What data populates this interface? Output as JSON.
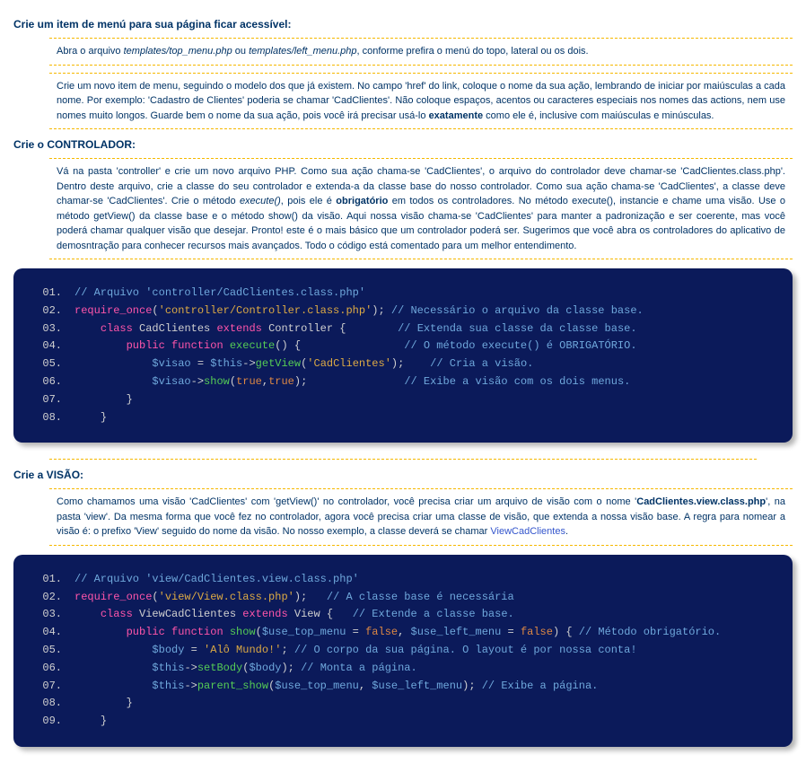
{
  "section1": {
    "heading": "Crie um item de menú para sua página ficar acessível:",
    "para1_pre": "Abra o arquivo ",
    "para1_file1": "templates/top_menu.php",
    "para1_mid": " ou ",
    "para1_file2": "templates/left_menu.php",
    "para1_post": ", conforme prefira o menú do topo, lateral ou os dois.",
    "para2_a": "Crie um novo item de menu, seguindo o modelo dos que já existem. No campo 'href' do link, coloque o nome da sua ação, lembrando de iniciar por maiúsculas a cada nome. Por exemplo: 'Cadastro de Clientes' poderia se chamar 'CadClientes'. Não coloque espaços, acentos ou caracteres especiais nos nomes das actions, nem use nomes muito longos. Guarde bem o nome da sua ação, pois você irá precisar usá-lo ",
    "para2_b": "exatamente",
    "para2_c": " como ele é, inclusive com maiúsculas e minúsculas."
  },
  "section2": {
    "heading": "Crie o CONTROLADOR:",
    "para_a": "Vá na pasta 'controller' e crie um novo arquivo PHP. Como sua ação chama-se 'CadClientes', o arquivo do controlador deve chamar-se 'CadClientes.class.php'. Dentro deste arquivo, crie a classe do seu controlador e extenda-a da classe base do nosso controlador. Como sua ação chama-se 'CadClientes', a classe deve chamar-se 'CadClientes'. Crie o método ",
    "para_exec": "execute()",
    "para_b": ", pois ele é ",
    "para_obr": "obrigatório",
    "para_c": " em todos os controladores. No método execute(), instancie e chame uma visão. Use o método getView() da classe base e o método show() da visão. Aqui nossa visão chama-se 'CadClientes' para manter a padronização e ser coerente, mas você poderá chamar qualquer visão que desejar. Pronto! este é o mais básico que um controlador poderá ser. Sugerimos que você abra os controladores do aplicativo de demosntração para conhecer recursos mais avançados. Todo o código está comentado para um melhor entendimento."
  },
  "code1": {
    "l1_cmt": "// Arquivo 'controller/CadClientes.class.php'",
    "l2_kw": "require_once",
    "l2_op1": "(",
    "l2_str": "'controller/Controller.class.php'",
    "l2_op2": ");",
    "l2_cmt": " // Necessário o arquivo da classe base.",
    "l3_kw1": "class",
    "l3_name": " CadClientes ",
    "l3_kw2": "extends",
    "l3_base": " Controller ",
    "l3_op": "{",
    "l3_cmt": "        // Extenda sua classe da classe base.",
    "l4_kw1": "public ",
    "l4_kw2": "function ",
    "l4_fn": "execute",
    "l4_op": "() {",
    "l4_cmt": "                // O método execute() é OBRIGATÓRIO.",
    "l5_var": "$visao",
    "l5_op1": " = ",
    "l5_this": "$this",
    "l5_arrow": "->",
    "l5_fn": "getView",
    "l5_op2": "(",
    "l5_str": "'CadClientes'",
    "l5_op3": ");",
    "l5_cmt": "    // Cria a visão.",
    "l6_var": "$visao",
    "l6_arrow": "->",
    "l6_fn": "show",
    "l6_op1": "(",
    "l6_t1": "true",
    "l6_c": ",",
    "l6_t2": "true",
    "l6_op2": ");",
    "l6_cmt": "               // Exibe a visão com os dois menus.",
    "l7_brace": "}",
    "l8_brace": "}"
  },
  "section3": {
    "heading": "Crie a VISÃO:",
    "para_a": "Como chamamos uma visão 'CadClientes' com 'getView()' no controlador, você precisa criar um arquivo de visão com o nome '",
    "para_file": "CadClientes.view.class.php",
    "para_b": "', na pasta 'view'. Da mesma forma que você fez no controlador, agora você precisa criar uma classe de visão, que extenda a nossa visão base. A regra para nomear a visão é: o prefixo 'View' seguido do nome da visão. No nosso exemplo, a classe deverá se chamar ",
    "para_link": "ViewCadClientes",
    "para_c": "."
  },
  "code2": {
    "l1_cmt": "// Arquivo 'view/CadClientes.view.class.php'",
    "l2_kw": "require_once",
    "l2_op1": "(",
    "l2_str": "'view/View.class.php'",
    "l2_op2": ");",
    "l2_cmt": "   // A classe base é necessária",
    "l3_kw1": "class",
    "l3_name": " ViewCadClientes ",
    "l3_kw2": "extends",
    "l3_base": " View ",
    "l3_op": "{",
    "l3_cmt": "   // Extende a classe base.",
    "l4_kw1": "public ",
    "l4_kw2": "function ",
    "l4_fn": "show",
    "l4_op1": "(",
    "l4_v1": "$use_top_menu",
    "l4_eq1": " = ",
    "l4_f1": "false",
    "l4_c1": ", ",
    "l4_v2": "$use_left_menu",
    "l4_eq2": " = ",
    "l4_f2": "false",
    "l4_op2": ") {",
    "l4_cmt": " // Método obrigatório.",
    "l5_var": "$body",
    "l5_eq": " = ",
    "l5_str": "'Alô Mundo!'",
    "l5_sc": ";",
    "l5_cmt": " // O corpo da sua página. O layout é por nossa conta!",
    "l6_this": "$this",
    "l6_arrow": "->",
    "l6_fn": "setBody",
    "l6_op1": "(",
    "l6_var": "$body",
    "l6_op2": ");",
    "l6_cmt": " // Monta a página.",
    "l7_this": "$this",
    "l7_arrow": "->",
    "l7_fn": "parent_show",
    "l7_op1": "(",
    "l7_v1": "$use_top_menu",
    "l7_c": ", ",
    "l7_v2": "$use_left_menu",
    "l7_op2": ");",
    "l7_cmt": " // Exibe a página.",
    "l8_brace": "}",
    "l9_brace": "}"
  },
  "ln": {
    "n1": "01.",
    "n2": "02.",
    "n3": "03.",
    "n4": "04.",
    "n5": "05.",
    "n6": "06.",
    "n7": "07.",
    "n8": "08.",
    "n9": "09."
  }
}
